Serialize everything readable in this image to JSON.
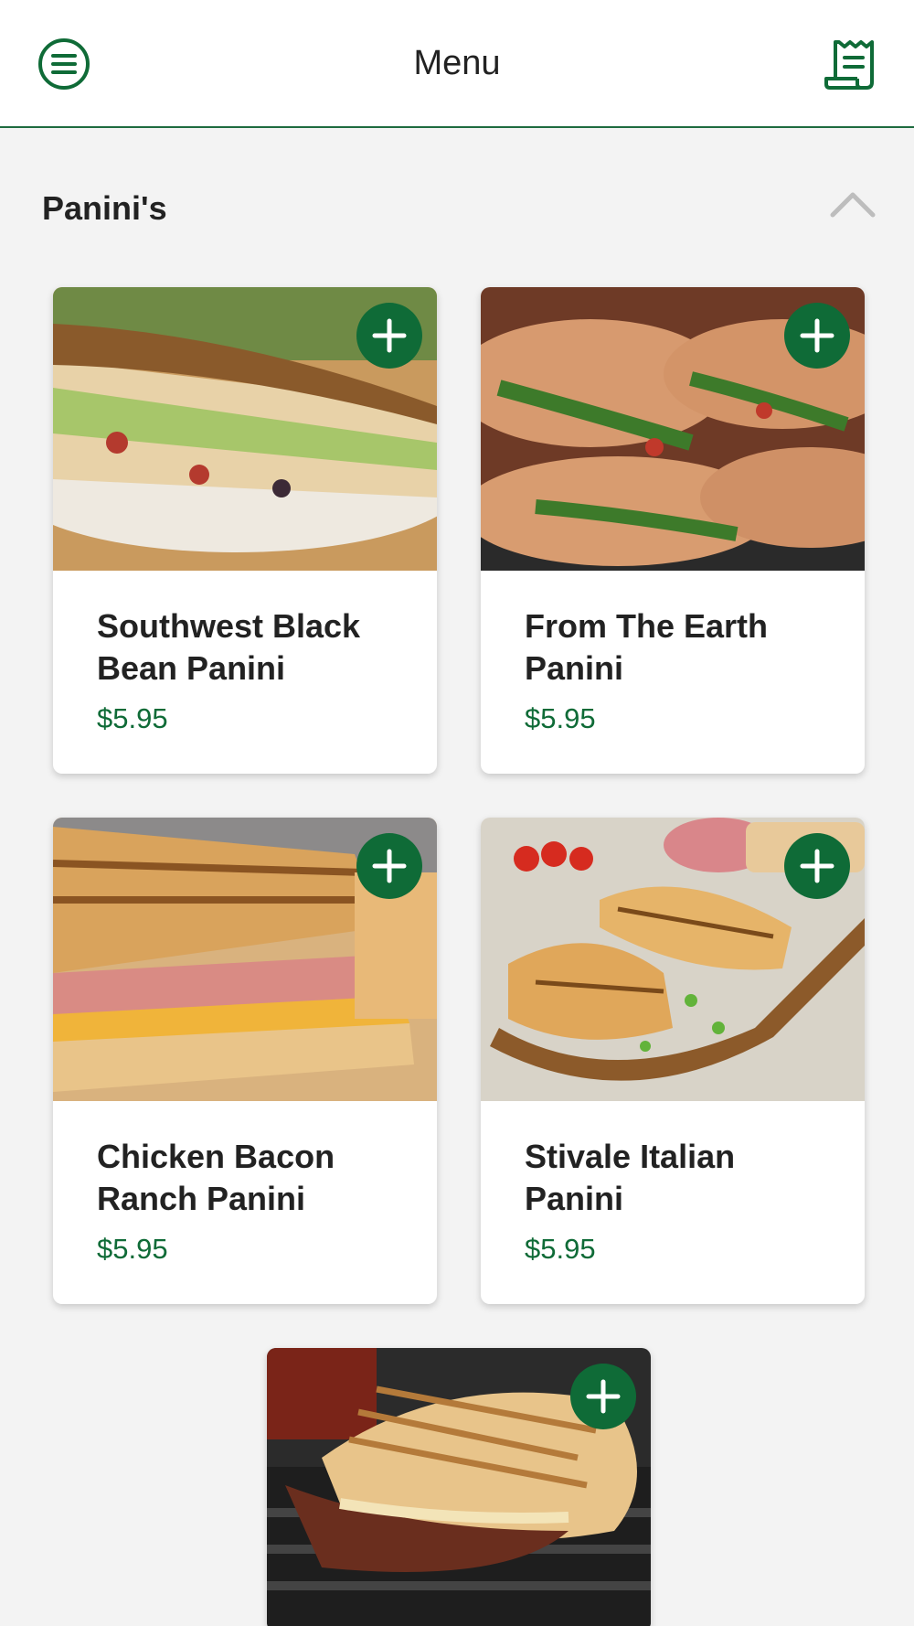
{
  "header": {
    "title": "Menu",
    "menu_icon": "hamburger-circle-icon",
    "receipt_icon": "receipt-icon"
  },
  "colors": {
    "brand_green": "#0f6b37",
    "header_border": "#1e6b3f",
    "background": "#f3f3f3"
  },
  "section": {
    "title": "Panini's",
    "collapse_icon": "chevron-up-icon"
  },
  "items": [
    {
      "name": "Southwest Black Bean Panini",
      "price": "$5.95",
      "image": "panini-sandwich-photo"
    },
    {
      "name": "From The Earth Panini",
      "price": "$5.95",
      "image": "ciabatta-sandwiches-photo"
    },
    {
      "name": "Chicken Bacon Ranch Panini",
      "price": "$5.95",
      "image": "grilled-panini-photo"
    },
    {
      "name": "Stivale Italian Panini",
      "price": "$5.95",
      "image": "panini-on-board-photo"
    },
    {
      "name": "",
      "price": "",
      "image": "flatbread-panini-photo"
    }
  ]
}
